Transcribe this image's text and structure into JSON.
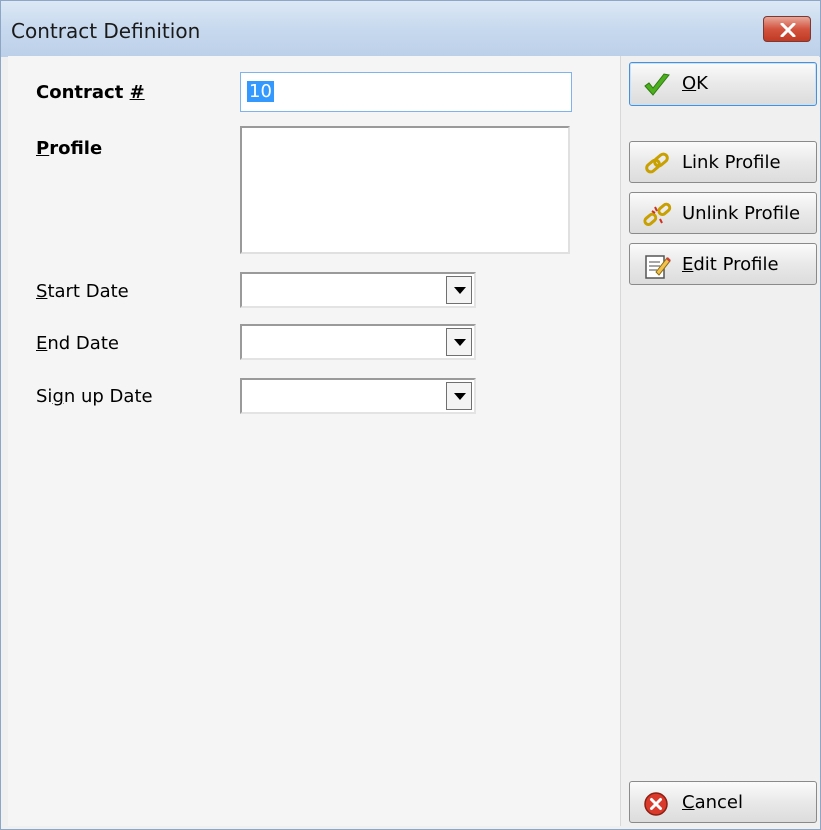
{
  "window": {
    "title": "Contract Definition"
  },
  "form": {
    "contract_label_text": "Contract ",
    "contract_label_key": "#",
    "contract_value": "10",
    "profile_label_key": "P",
    "profile_label_rest": "rofile",
    "start_key": "S",
    "start_rest": "tart Date",
    "end_key": "E",
    "end_rest": "nd Date",
    "signup_pre": "Si",
    "signup_key": "g",
    "signup_rest": "n up Date"
  },
  "buttons": {
    "ok_key": "O",
    "ok_rest": "K",
    "link_profile": "Link Profile",
    "unlink_profile": "Unlink Profile",
    "edit_key": "E",
    "edit_rest": "dit Profile",
    "cancel_key": "C",
    "cancel_rest": "ancel"
  },
  "icons": {
    "ok": "checkmark-icon",
    "link": "chain-link-icon",
    "unlink": "broken-chain-icon",
    "edit": "edit-document-icon",
    "cancel": "red-x-circle-icon",
    "close": "close-icon",
    "dropdown": "dropdown-arrow-icon"
  },
  "colors": {
    "titlebar": "#c7d9ee",
    "close_button": "#d2533e",
    "selection": "#3399ff",
    "ok_border": "#4d8fd6"
  }
}
